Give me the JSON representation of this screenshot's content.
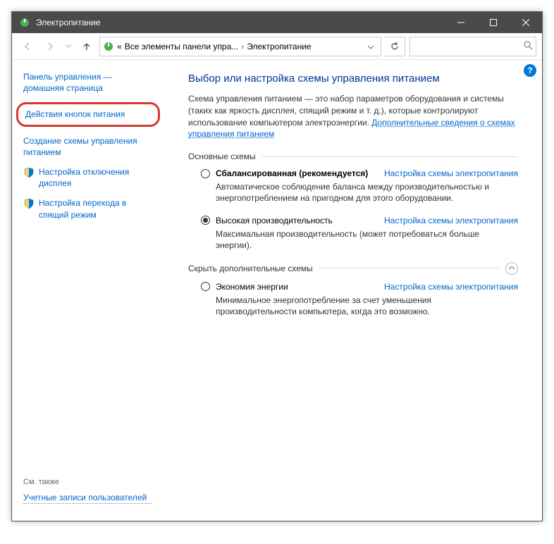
{
  "titlebar": {
    "title": "Электропитание"
  },
  "breadcrumb": {
    "item1": "Все элементы панели упра...",
    "item2": "Электропитание"
  },
  "sidebar": {
    "home": "Панель управления — домашняя страница",
    "buttons": "Действия кнопок питания",
    "create_plan": "Создание схемы управления питанием",
    "display_off": "Настройка отключения дисплея",
    "sleep": "Настройка перехода в спящий режим",
    "see_also": "См. также",
    "user_accounts": "Учетные записи пользователей"
  },
  "main": {
    "title": "Выбор или настройка схемы управления питанием",
    "intro_pre": "Схема управления питанием — это набор параметров оборудования и системы (таких как яркость дисплея, спящий режим и т. д.), которые контролируют использование компьютером электроэнергии. ",
    "intro_link": "Дополнительные сведения о схемах управления питанием",
    "section_basic": "Основные схемы",
    "section_additional": "Скрыть дополнительные схемы",
    "configure_link": "Настройка схемы электропитания",
    "plans": {
      "balanced": {
        "name": "Сбалансированная (рекомендуется)",
        "desc": "Автоматическое соблюдение баланса между производительностью и энергопотреблением на пригодном для этого оборудовании."
      },
      "high": {
        "name": "Высокая производительность",
        "desc": "Максимальная производительность (может потребоваться больше энергии)."
      },
      "saver": {
        "name": "Экономия энергии",
        "desc": "Минимальное энергопотребление за счет уменьшения производительности компьютера, когда это возможно."
      }
    }
  }
}
